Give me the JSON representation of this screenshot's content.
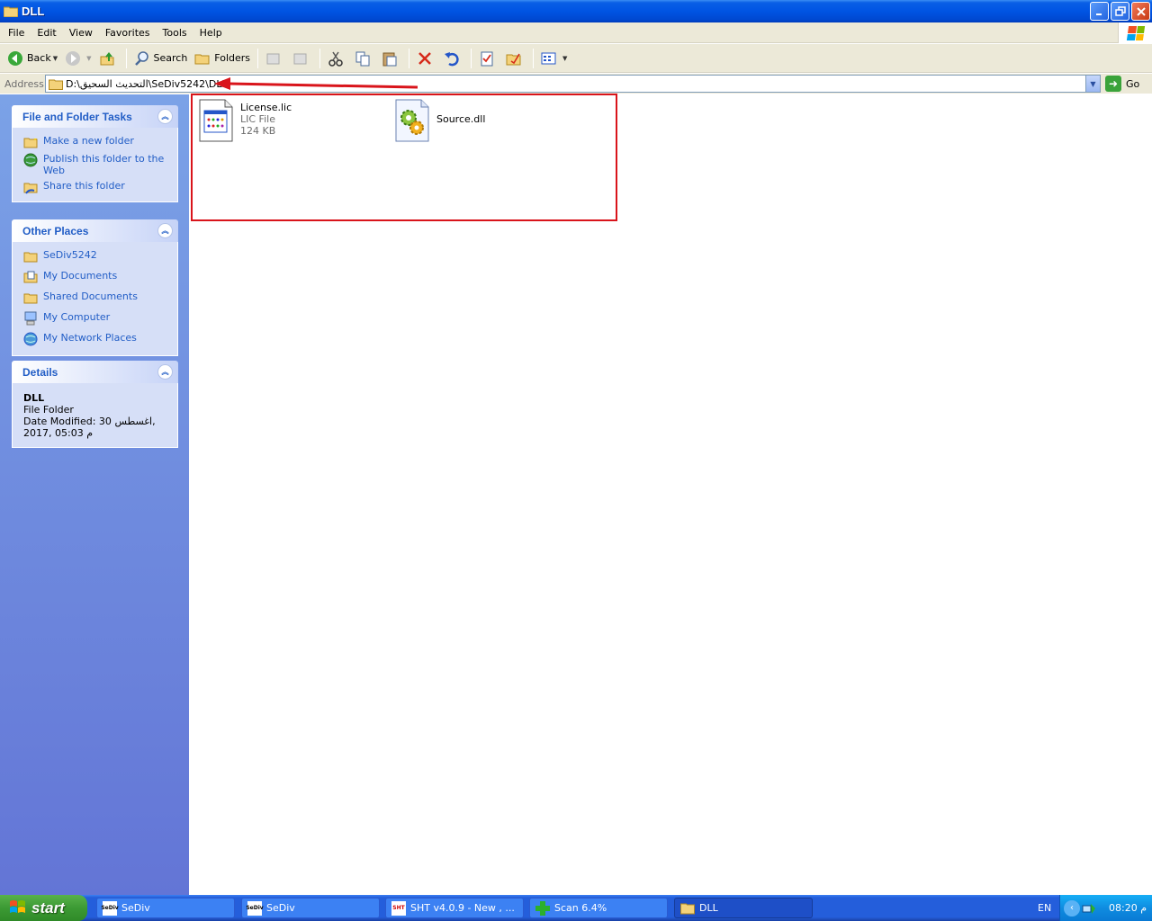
{
  "window": {
    "title": "DLL"
  },
  "menu": [
    "File",
    "Edit",
    "View",
    "Favorites",
    "Tools",
    "Help"
  ],
  "toolbar": {
    "back": "Back",
    "search": "Search",
    "folders": "Folders"
  },
  "address": {
    "label": "Address",
    "path": "D:\\التحديث السحيق\\SeDiv5242\\DLL",
    "go": "Go"
  },
  "taskpane": {
    "file_tasks": {
      "title": "File and Folder Tasks",
      "items": [
        "Make a new folder",
        "Publish this folder to the Web",
        "Share this folder"
      ]
    },
    "other_places": {
      "title": "Other Places",
      "items": [
        "SeDiv5242",
        "My Documents",
        "Shared Documents",
        "My Computer",
        "My Network Places"
      ]
    },
    "details": {
      "title": "Details",
      "name": "DLL",
      "type": "File Folder",
      "modified_line1": "Date Modified: 30 اغسطس,",
      "modified_line2": "2017, 05:03 م"
    }
  },
  "files": [
    {
      "name": "License.lic",
      "type": "LIC File",
      "size": "124 KB"
    },
    {
      "name": "Source.dll"
    }
  ],
  "taskbar": {
    "start": "start",
    "buttons": [
      "SeDiv",
      "SeDiv",
      "SHT v4.0.9 - New  , ...",
      "Scan 6.4%",
      "DLL"
    ],
    "lang": "EN",
    "clock": "08:20 م"
  },
  "colors": {
    "title_blue": "#0054e3",
    "link_blue": "#215dc6",
    "highlight_red": "#d9141b"
  }
}
